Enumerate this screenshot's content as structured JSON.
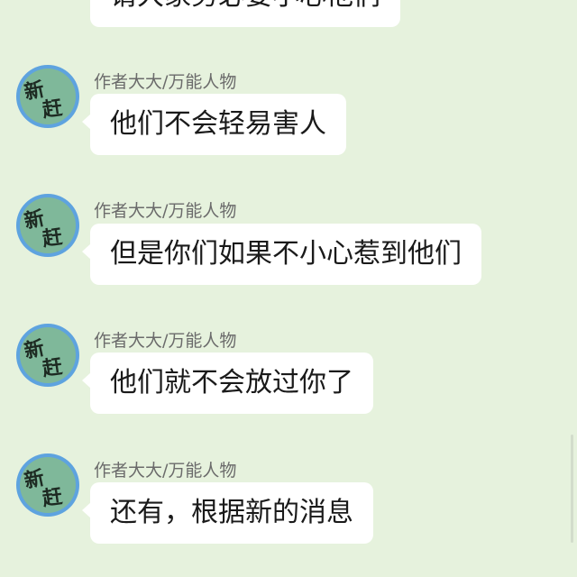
{
  "chat": {
    "top_partial_message": "请大家务必要小心他们",
    "messages": [
      {
        "sender": "作者大大/万能人物",
        "avatar_chars": [
          "新",
          "赶"
        ],
        "text": "他们不会轻易害人"
      },
      {
        "sender": "作者大大/万能人物",
        "avatar_chars": [
          "新",
          "赶"
        ],
        "text": "但是你们如果不小心惹到他们"
      },
      {
        "sender": "作者大大/万能人物",
        "avatar_chars": [
          "新",
          "赶"
        ],
        "text": "他们就不会放过你了"
      },
      {
        "sender": "作者大大/万能人物",
        "avatar_chars": [
          "新",
          "赶"
        ],
        "text": "还有，根据新的消息"
      }
    ]
  },
  "colors": {
    "background": "#e6f2dd",
    "bubble": "#ffffff",
    "avatar_ring": "#5ea3df",
    "avatar_fill": "#7fb89a"
  }
}
